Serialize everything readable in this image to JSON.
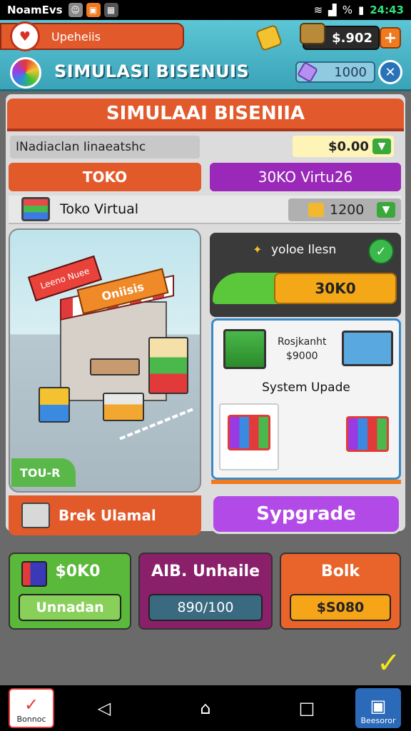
{
  "status_bar": {
    "app_name": "NoamEvs",
    "battery_percent": "%",
    "time": "24:43"
  },
  "header": {
    "player_label": "Upeheiis",
    "money": "$.902",
    "add_label": "+",
    "title": "SIMULASI BISENUIS",
    "gems": "1000",
    "close_label": "✕"
  },
  "panel": {
    "title": "SIMULAAI BISENIIA",
    "row_label": "INadiaclan Iinaeatshc",
    "row_price": "$0.00",
    "tabs": [
      {
        "label": "TOKO"
      },
      {
        "label": "30KO Virtu26"
      }
    ],
    "store_name": "Toko Virtual",
    "store_price": "1200"
  },
  "scene": {
    "sign_small": "Leeno Nuee",
    "sign_big": "Oniisis",
    "badge": "TOU-R",
    "footer_label": "Brek Ulamal"
  },
  "virtual": {
    "label": "yoloe Ilesn",
    "button": "30K0"
  },
  "upgrade": {
    "item_name": "Rosjkanht",
    "item_price": "$9000",
    "title": "System Upade",
    "button": "Sypgrade"
  },
  "bottom_cards": [
    {
      "title": "$0K0",
      "button": "Unnadan"
    },
    {
      "title": "AIB. Unhaile",
      "button": "890/100"
    },
    {
      "title": "Bolk",
      "button": "$S080"
    }
  ],
  "nav": {
    "left_app": "Bonnoc",
    "right_app": "Beesoror"
  },
  "colors": {
    "accent_orange": "#e25a2c",
    "accent_purple": "#9a28b8",
    "accent_green": "#5ab83a"
  }
}
